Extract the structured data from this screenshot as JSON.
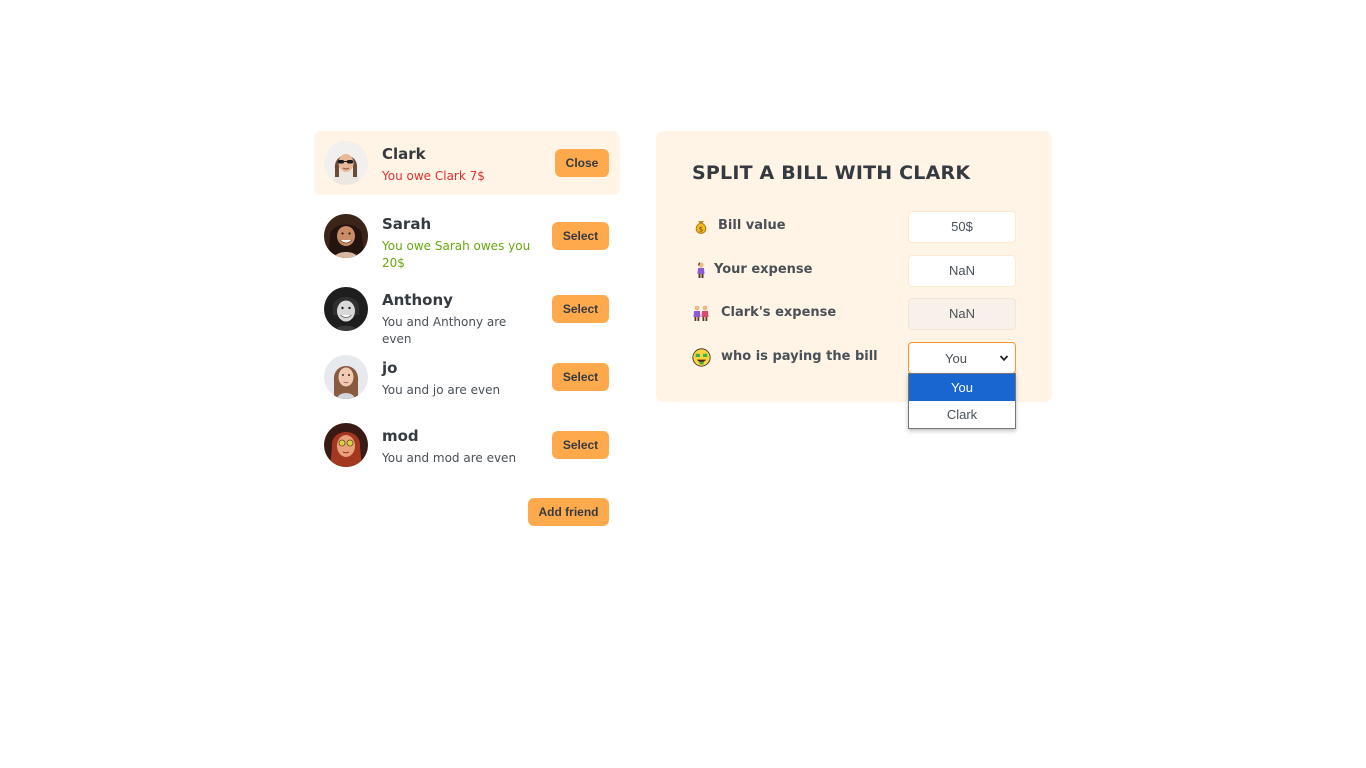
{
  "friends": [
    {
      "name": "Clark",
      "status": "You owe Clark 7$",
      "button": "Close",
      "tone": "red"
    },
    {
      "name": "Sarah",
      "status": "You owe Sarah owes you 20$",
      "button": "Select",
      "tone": "green"
    },
    {
      "name": "Anthony",
      "status": "You and Anthony are even",
      "button": "Select",
      "tone": "neutral"
    },
    {
      "name": "jo",
      "status": "You and jo are even",
      "button": "Select",
      "tone": "neutral"
    },
    {
      "name": "mod",
      "status": "You and mod are even",
      "button": "Select",
      "tone": "neutral"
    }
  ],
  "add_friend_label": "Add friend",
  "form": {
    "title": "SPLIT A BILL WITH CLARK",
    "bill_label": "Bill value",
    "bill_value": "50$",
    "your_expense_label": "Your expense",
    "your_expense_value": "NaN",
    "friend_expense_label": "Clark's expense",
    "friend_expense_value": "NaN",
    "payer_label": "who is paying the bill",
    "payer_value": "You",
    "payer_options": [
      "You",
      "Clark"
    ]
  },
  "icons": {
    "bill": "money-bag-icon",
    "your_expense": "person-icon",
    "friend_expense": "two-people-icon",
    "payer": "money-face-icon"
  },
  "colors": {
    "accent": "#ffa94d",
    "panel": "#fff4e6",
    "owe": "#e03131",
    "owed": "#66a80f",
    "option_highlight": "#1a66d1"
  }
}
